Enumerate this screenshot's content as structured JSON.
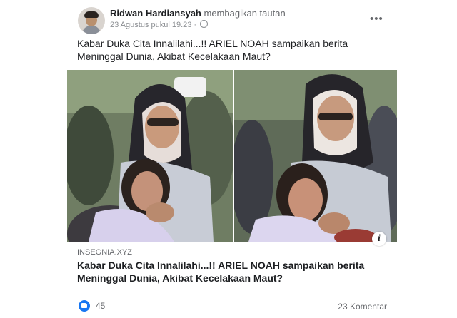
{
  "post": {
    "author": "Ridwan Hardiansyah",
    "action": "membagikan tautan",
    "timestamp": "23 Agustus pukul 19.23 ·",
    "privacy_icon": "globe-icon",
    "text": "Kabar Duka Cita Innalilahi...!! ARIEL NOAH sampaikan berita Meninggal Dunia, Akibat Kecelakaan Maut?"
  },
  "link_preview": {
    "domain": "INSEGNIA.XYZ",
    "title": "Kabar Duka Cita Innalilahi...!! ARIEL NOAH sampaikan berita Meninggal Dunia, Akibat Kecelakaan Maut?",
    "info_icon": "i"
  },
  "footer": {
    "like_count": "45",
    "comments": "23 Komentar"
  },
  "menu_label": "•••"
}
